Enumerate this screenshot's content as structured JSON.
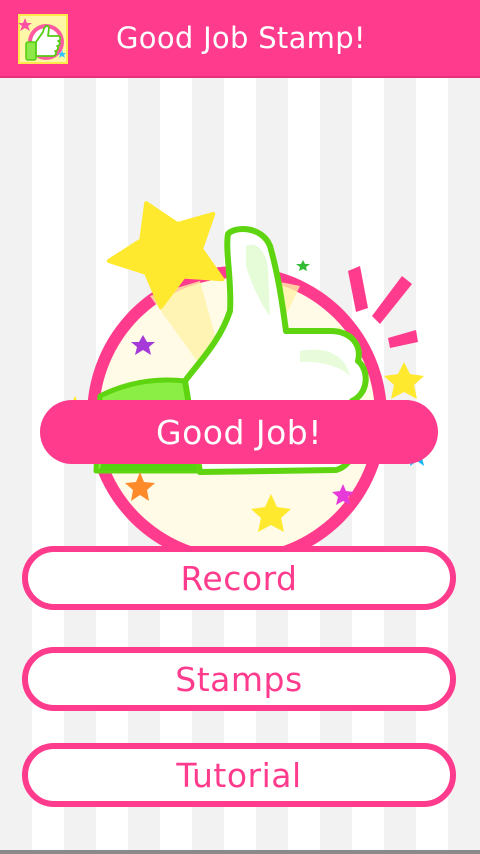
{
  "appbar": {
    "title": "Good Job Stamp!",
    "icon": "thumbs-up-app-icon",
    "background_color": "#ff3b8d"
  },
  "hero": {
    "banner_text": "Good Job!",
    "illustration": "thumbs-up-stamp"
  },
  "menu": {
    "record_label": "Record",
    "stamps_label": "Stamps",
    "tutorial_label": "Tutorial"
  },
  "colors": {
    "accent": "#ff3b8d",
    "thumb_fill": "#ffffff",
    "thumb_outline": "#66dd11",
    "sleeve": "#88ee44",
    "star_yellow": "#ffee33"
  }
}
